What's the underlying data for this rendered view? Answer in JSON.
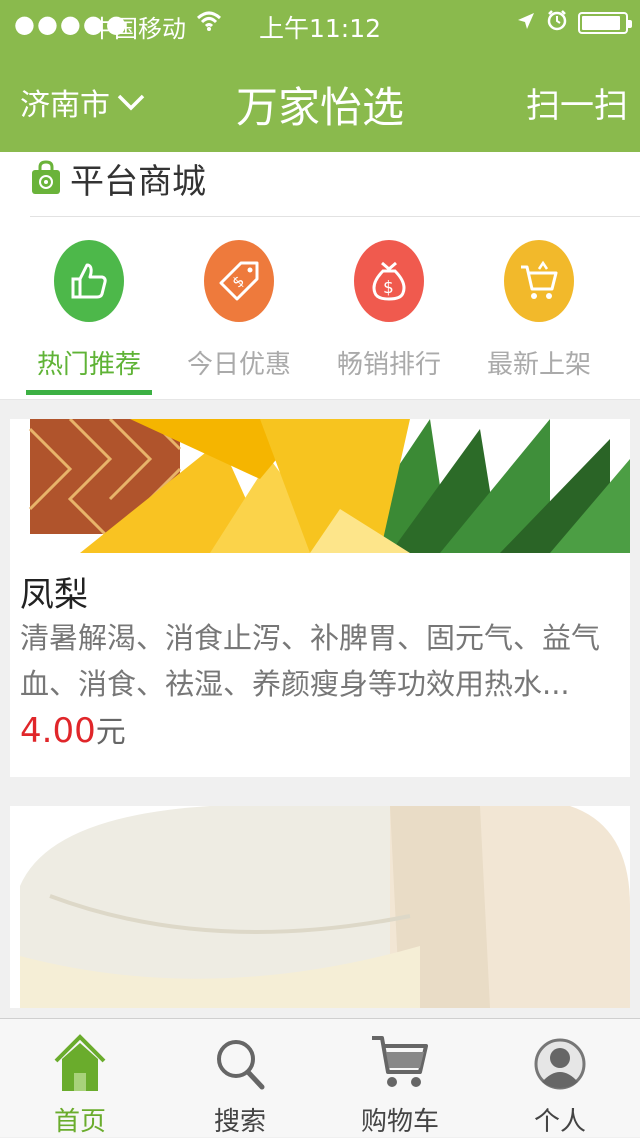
{
  "status_bar": {
    "signal": "●●●●●",
    "carrier": "中国移动",
    "time": "上午11:12"
  },
  "nav": {
    "city": "济南市",
    "title": "万家怡选",
    "scan": "扫一扫"
  },
  "mall": {
    "label": "平台商城"
  },
  "categories": [
    {
      "label": "热门推荐",
      "icon": "thumbs-up-icon",
      "color": "#4db84a",
      "active": true
    },
    {
      "label": "今日优惠",
      "icon": "price-tag-icon",
      "color": "#ee7a3c",
      "active": false
    },
    {
      "label": "畅销排行",
      "icon": "money-bag-icon",
      "color": "#f05a4e",
      "active": false
    },
    {
      "label": "最新上架",
      "icon": "cart-new-icon",
      "color": "#f2b92b",
      "active": false
    }
  ],
  "products": [
    {
      "name": "凤梨",
      "description": "清暑解渴、消食止泻、补脾胃、固元气、益气血、消食、祛湿、养颜瘦身等功效用热水...",
      "price": "4.00",
      "unit": "元",
      "image": "pineapple"
    },
    {
      "image": "coconut"
    }
  ],
  "tabs": [
    {
      "label": "首页",
      "icon": "home-icon",
      "active": true
    },
    {
      "label": "搜索",
      "icon": "search-icon",
      "active": false
    },
    {
      "label": "购物车",
      "icon": "cart-icon",
      "active": false
    },
    {
      "label": "个人",
      "icon": "profile-icon",
      "active": false
    }
  ],
  "colors": {
    "brand_green": "#8aba4d",
    "active_green": "#5fb336",
    "price_red": "#e0262a"
  }
}
